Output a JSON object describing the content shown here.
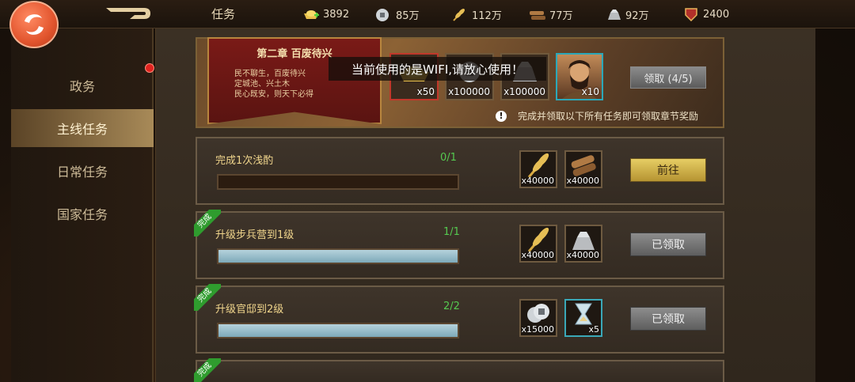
{
  "header": {
    "title": "任务",
    "resources": [
      {
        "icon": "gold-ingot-icon",
        "value": "3892"
      },
      {
        "icon": "silver-coin-icon",
        "value": "85万"
      },
      {
        "icon": "grain-icon",
        "value": "112万"
      },
      {
        "icon": "wood-icon",
        "value": "77万"
      },
      {
        "icon": "iron-icon",
        "value": "92万"
      },
      {
        "icon": "shield-badge-icon",
        "value": "2400"
      }
    ]
  },
  "sidebar": {
    "items": [
      {
        "label": "政务",
        "active": false,
        "badge": true
      },
      {
        "label": "主线任务",
        "active": true,
        "badge": false
      },
      {
        "label": "日常任务",
        "active": false,
        "badge": false
      },
      {
        "label": "国家任务",
        "active": false,
        "badge": false
      }
    ]
  },
  "chapter": {
    "title": "第二章 百废待兴",
    "desc_lines": [
      "民不聊生，百废待兴",
      "定城池、兴土木",
      "民心既安，则天下必得"
    ],
    "rewards": [
      {
        "icon": "gold-ingot-icon",
        "qty": "x50"
      },
      {
        "icon": "silver-coin-icon",
        "qty": "x100000"
      },
      {
        "icon": "iron-icon",
        "qty": "x100000"
      },
      {
        "icon": "hero-portrait-icon",
        "qty": "x10"
      }
    ],
    "claim_label": "领取 (4/5)",
    "notice": "完成并领取以下所有任务即可领取章节奖励"
  },
  "toast": "当前使用的是WIFI,请放心使用！",
  "tasks": [
    {
      "name": "完成1次浅酌",
      "progress": "0/1",
      "fraction": 0,
      "completed": false,
      "rewards": [
        {
          "icon": "grain-icon",
          "qty": "x40000"
        },
        {
          "icon": "wood-icon",
          "qty": "x40000"
        }
      ],
      "button": "前往"
    },
    {
      "name": "升级步兵营到1级",
      "progress": "1/1",
      "fraction": 1,
      "completed": true,
      "rewards": [
        {
          "icon": "grain-icon",
          "qty": "x40000"
        },
        {
          "icon": "iron-icon",
          "qty": "x40000"
        }
      ],
      "button": "已领取"
    },
    {
      "name": "升级官邸到2级",
      "progress": "2/2",
      "fraction": 1,
      "completed": true,
      "rewards": [
        {
          "icon": "silver-coin-icon",
          "qty": "x15000"
        },
        {
          "icon": "hourglass-icon",
          "qty": "x5"
        }
      ],
      "button": "已领取"
    }
  ],
  "ribbon_label": "完成",
  "colors": {
    "accent_gold": "#e6cd64",
    "complete_green": "#2f9c2e",
    "progress_green": "#55c950"
  }
}
